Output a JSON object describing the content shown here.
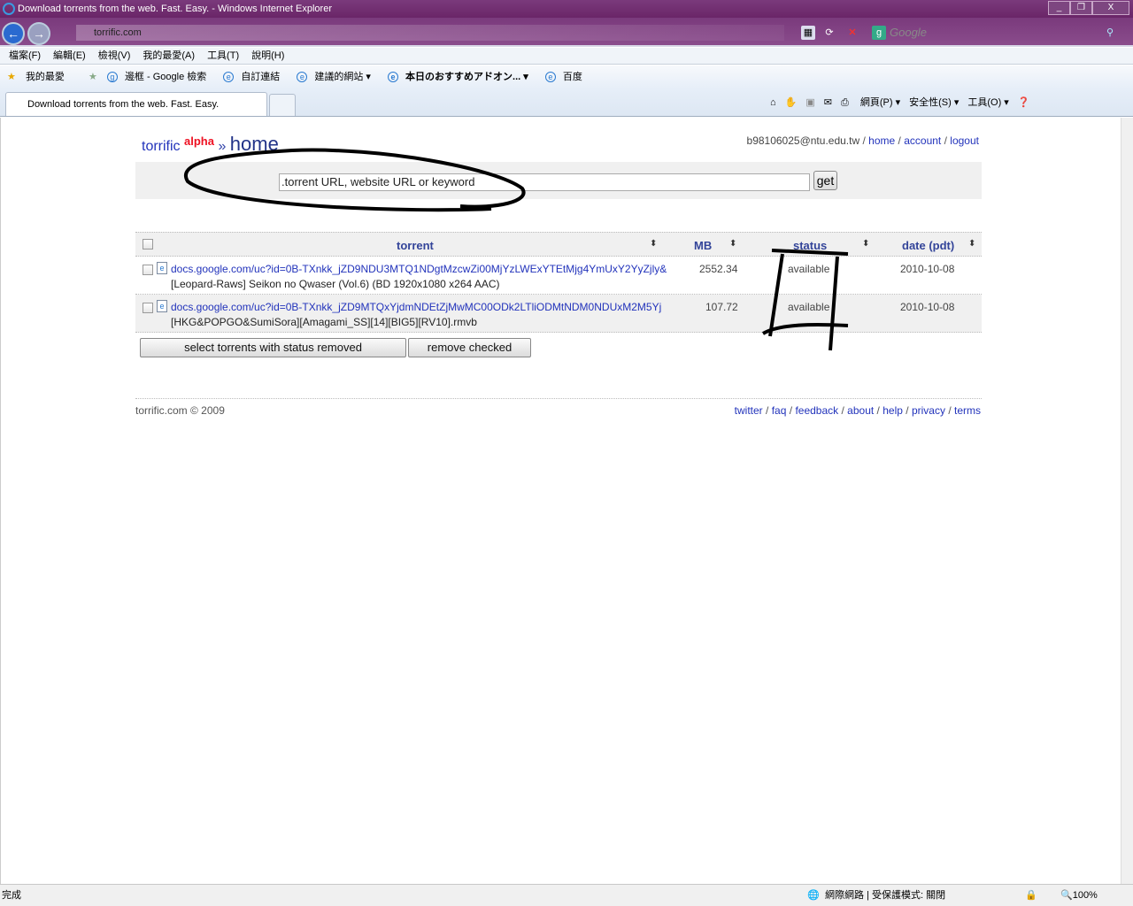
{
  "window": {
    "title": "Download torrents from the web. Fast. Easy. - Windows Internet Explorer",
    "minimize": "_",
    "restore": "❐",
    "close": "X"
  },
  "address": {
    "url": "torrific.com",
    "search_placeholder": "Google"
  },
  "menu": [
    "檔案(F)",
    "編輯(E)",
    "檢視(V)",
    "我的最愛(A)",
    "工具(T)",
    "說明(H)"
  ],
  "favorites": {
    "label": "我的最愛",
    "items": [
      "邊框 - Google 檢索",
      "自訂連結",
      "建議的網站 ▾",
      "本日のおすすめアドオン... ▾",
      "百度"
    ]
  },
  "tab": {
    "title": "Download torrents from the web. Fast. Easy."
  },
  "commands": [
    "網頁(P) ▾",
    "安全性(S) ▾",
    "工具(O) ▾"
  ],
  "page": {
    "brand": "torrific",
    "alpha": "alpha",
    "sep": "»",
    "section": "home",
    "user": {
      "email": "b98106025@ntu.edu.tw",
      "links": [
        "home",
        "account",
        "logout"
      ]
    },
    "search": {
      "value": ".torrent URL, website URL or keyword",
      "button": "get"
    },
    "table": {
      "headers": [
        "torrent",
        "MB",
        "status",
        "date (pdt)"
      ],
      "rows": [
        {
          "url": "docs.google.com/uc?id=0B-TXnkk_jZD9NDU3MTQ1NDgtMzcwZi00MjYzLWExYTEtMjg4YmUxY2YyZjly&",
          "name": "[Leopard-Raws] Seikon no Qwaser (Vol.6) (BD 1920x1080 x264 AAC)",
          "mb": "2552.34",
          "status": "available",
          "date": "2010-10-08"
        },
        {
          "url": "docs.google.com/uc?id=0B-TXnkk_jZD9MTQxYjdmNDEtZjMwMC00ODk2LTliODMtNDM0NDUxM2M5Yj",
          "name": "[HKG&POPGO&SumiSora][Amagami_SS][14][BIG5][RV10].rmvb",
          "mb": "107.72",
          "status": "available",
          "date": "2010-10-08"
        }
      ]
    },
    "buttons": {
      "select_removed": "select torrents with status removed",
      "remove_checked": "remove checked"
    },
    "footer": {
      "copyright": "torrific.com © 2009",
      "links": [
        "twitter",
        "faq",
        "feedback",
        "about",
        "help",
        "privacy",
        "terms"
      ]
    }
  },
  "status": {
    "text": "完成",
    "zone": "網際網路 | 受保護模式: 關閉",
    "zoom": "100%"
  }
}
